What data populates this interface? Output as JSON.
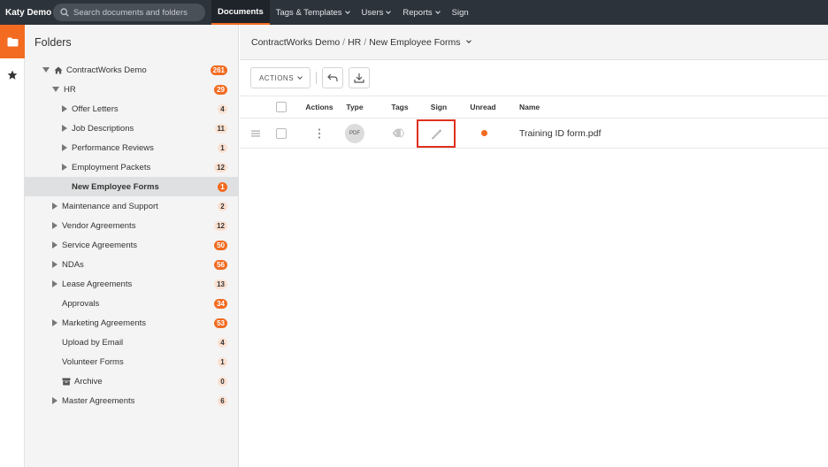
{
  "topnav": {
    "brand": "Katy Demo",
    "search_placeholder": "Search documents and folders",
    "items": [
      {
        "label": "Documents",
        "active": true,
        "dropdown": false
      },
      {
        "label": "Tags & Templates",
        "active": false,
        "dropdown": true
      },
      {
        "label": "Users",
        "active": false,
        "dropdown": true
      },
      {
        "label": "Reports",
        "active": false,
        "dropdown": true
      },
      {
        "label": "Sign",
        "active": false,
        "dropdown": false
      }
    ]
  },
  "rail": {
    "items": [
      {
        "icon": "folder-icon",
        "active": true
      },
      {
        "icon": "star-icon",
        "active": false
      }
    ]
  },
  "folders": {
    "title": "Folders",
    "items": [
      {
        "label": "ContractWorks Demo",
        "count": "261",
        "icon": "home-icon",
        "expanded": true
      },
      {
        "label": "HR",
        "count": "29",
        "expanded": true
      },
      {
        "label": "Offer Letters",
        "count": "4"
      },
      {
        "label": "Job Descriptions",
        "count": "11"
      },
      {
        "label": "Performance Reviews",
        "count": "1"
      },
      {
        "label": "Employment Packets",
        "count": "12"
      },
      {
        "label": "New Employee Forms",
        "count": "1",
        "selected": true
      },
      {
        "label": "Maintenance and Support",
        "count": "2"
      },
      {
        "label": "Vendor Agreements",
        "count": "12"
      },
      {
        "label": "Service Agreements",
        "count": "50"
      },
      {
        "label": "NDAs",
        "count": "56"
      },
      {
        "label": "Lease Agreements",
        "count": "13"
      },
      {
        "label": "Approvals",
        "count": "34"
      },
      {
        "label": "Marketing Agreements",
        "count": "53"
      },
      {
        "label": "Upload by Email",
        "count": "4"
      },
      {
        "label": "Volunteer Forms",
        "count": "1"
      },
      {
        "label": "Archive",
        "count": "0",
        "icon": "archive-icon"
      },
      {
        "label": "Master Agreements",
        "count": "6"
      }
    ]
  },
  "breadcrumb": {
    "items": [
      "ContractWorks Demo",
      "HR",
      "New Employee Forms"
    ]
  },
  "toolbar": {
    "actions_label": "ACTIONS"
  },
  "table": {
    "columns": {
      "actions": "Actions",
      "type": "Type",
      "tags": "Tags",
      "sign": "Sign",
      "unread": "Unread",
      "name": "Name"
    },
    "rows": [
      {
        "type": "PDF",
        "unread": true,
        "name": "Training ID form.pdf"
      }
    ]
  },
  "colors": {
    "accent": "#f26b21",
    "nav_bg": "#2d333b",
    "highlight_border": "#e0301e"
  }
}
